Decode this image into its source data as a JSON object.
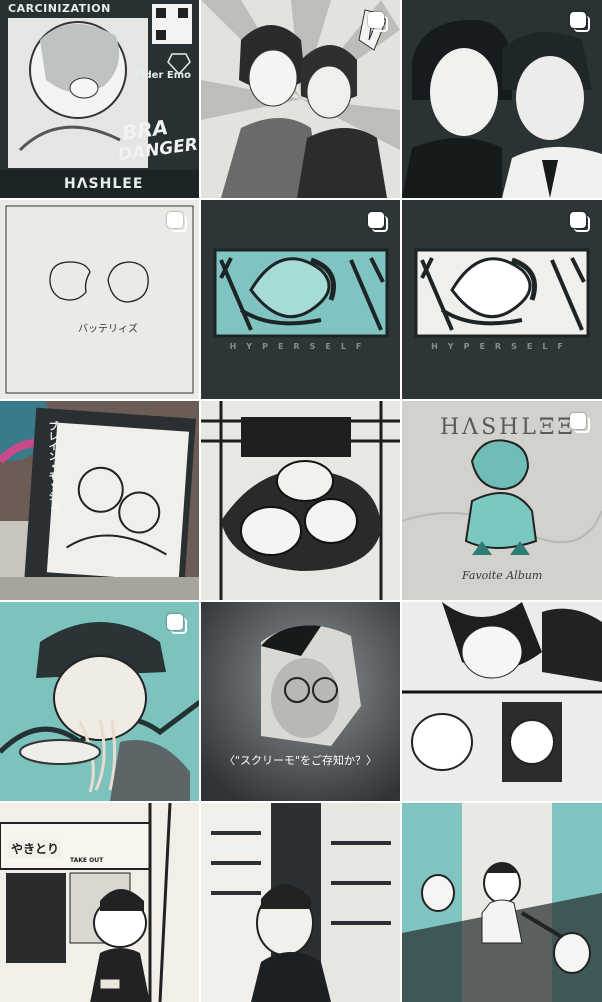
{
  "grid": {
    "tiles": [
      {
        "id": "post-1",
        "texts": {
          "carc": "CARCINIZATION",
          "elder": "Elder Emo",
          "hashlee": "HΛSHLEE",
          "bra": "BRA",
          "danger": "DANGER"
        },
        "multi": false
      },
      {
        "id": "post-2",
        "multi": true
      },
      {
        "id": "post-3",
        "multi": true
      },
      {
        "id": "post-4",
        "texts": {
          "battery": "バッテリィズ"
        },
        "multi": true
      },
      {
        "id": "post-5",
        "texts": {
          "hyper": "HYPERSELF"
        },
        "multi": true
      },
      {
        "id": "post-6",
        "texts": {
          "hyper": "HYPERSELF"
        },
        "multi": true
      },
      {
        "id": "post-7",
        "texts": {
          "vert": "ブレイン・モッシュ"
        },
        "multi": false
      },
      {
        "id": "post-8",
        "multi": false
      },
      {
        "id": "post-9",
        "texts": {
          "hashlee": "HΛSHLΞΞ",
          "favo": "Favoite Album"
        },
        "multi": true
      },
      {
        "id": "post-10",
        "multi": true
      },
      {
        "id": "post-11",
        "texts": {
          "caption": "〈\"スクリーモ\"をご存知か？〉"
        },
        "multi": false
      },
      {
        "id": "post-12",
        "multi": false
      },
      {
        "id": "post-13",
        "texts": {
          "yakitori": "やきとり",
          "takeout": "TAKE OUT"
        },
        "multi": false
      },
      {
        "id": "post-14",
        "multi": false
      },
      {
        "id": "post-15",
        "multi": false
      }
    ]
  },
  "colors": {
    "teal": "#7fc4c0",
    "dark": "#2b3335",
    "light": "#e9e7e1"
  },
  "icons": {
    "multi": "carousel-multiple-icon"
  }
}
